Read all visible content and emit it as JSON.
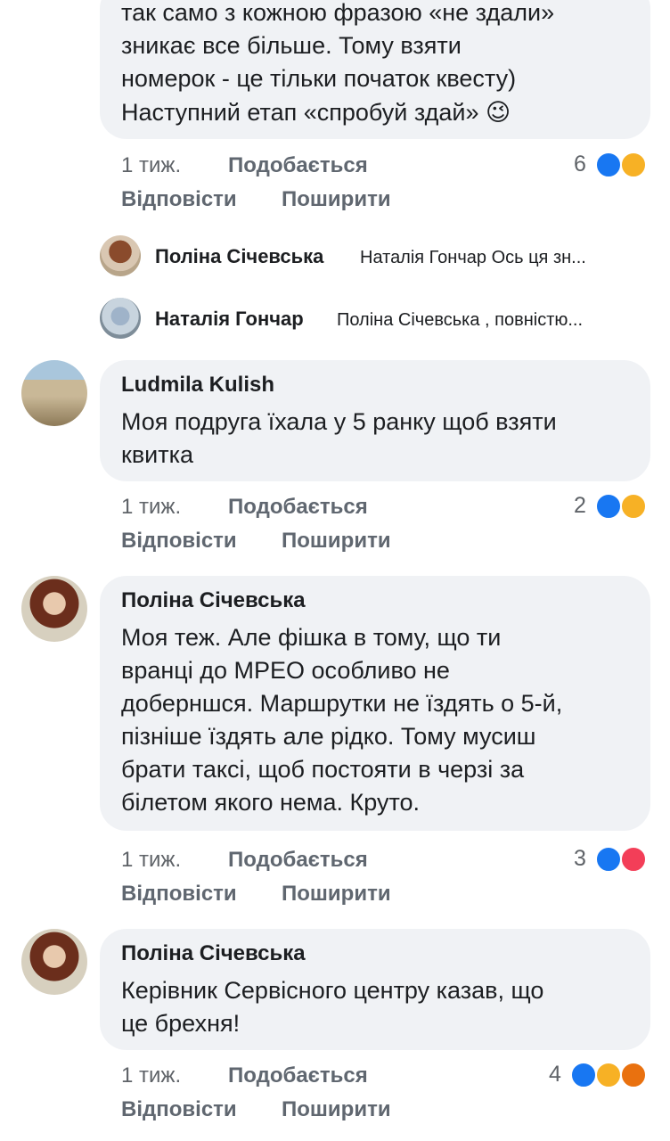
{
  "top_comment": {
    "lines": [
      "так само з кожною фразою «не здали»",
      "зникає все більше. Тому взяти",
      "номерок - це тільки початок квесту)",
      "Наступний етап «спробуй здай» 😉"
    ],
    "time": "1 тиж.",
    "like_label": "Подобається",
    "reply_label": "Відповісти",
    "share_label": "Поширити",
    "reaction_count": "6",
    "reactions": [
      "like-icon",
      "sad-icon"
    ]
  },
  "replies": [
    {
      "author": "Поліна Січевська",
      "preview": "Наталія Гончар Ось ця зн..."
    },
    {
      "author": "Наталія Гончар",
      "preview": "Поліна Січевська , повністю..."
    }
  ],
  "comments": [
    {
      "author": "Ludmila Kulish",
      "lines": [
        "Моя подруга їхала у 5 ранку щоб взяти",
        "квитка"
      ],
      "time": "1 тиж.",
      "like_label": "Подобається",
      "reply_label": "Відповісти",
      "share_label": "Поширити",
      "reaction_count": "2",
      "reactions": [
        "like-icon",
        "sad-icon"
      ]
    },
    {
      "author": "Поліна Січевська",
      "lines": [
        "Моя теж. Але фішка в тому, що ти",
        "вранці до МРЕО особливо не",
        "доберншся. Маршрутки не їздять о 5-й,",
        "пізніше їздять але рідко. Тому мусиш",
        "брати таксі, щоб постояти в черзі за",
        "білетом якого нема. Круто."
      ],
      "time": "1 тиж.",
      "like_label": "Подобається",
      "reply_label": "Відповісти",
      "share_label": "Поширити",
      "reaction_count": "3",
      "reactions": [
        "like-icon",
        "love-icon"
      ]
    },
    {
      "author": "Поліна Січевська",
      "lines": [
        "Керівник Сервісного центру казав, що",
        "це брехня!"
      ],
      "time": "1 тиж.",
      "like_label": "Подобається",
      "reply_label": "Відповісти",
      "share_label": "Поширити",
      "reaction_count": "4",
      "reactions": [
        "like-icon",
        "haha-icon",
        "angry-icon"
      ]
    }
  ],
  "colors": {
    "bubble": "#f0f2f5",
    "like": "#1877f2",
    "love": "#f33e58",
    "haha": "#f7b125",
    "angry": "#e9710f"
  }
}
